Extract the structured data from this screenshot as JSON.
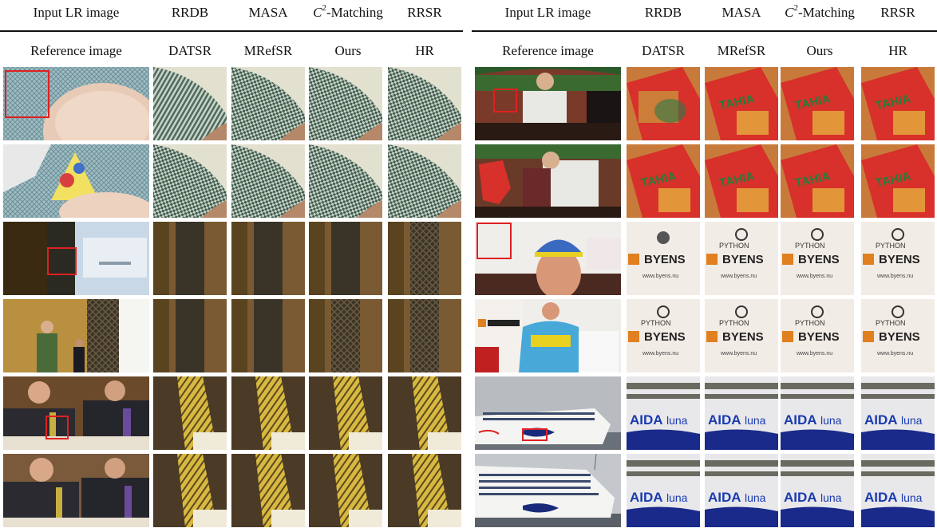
{
  "left_panel": {
    "header_row_1": [
      "Input LR image",
      "RRDB",
      "MASA",
      "C2-Matching",
      "RRSR"
    ],
    "header_row_2": [
      "Reference image",
      "DATSR",
      "MRefSR",
      "Ours",
      "HR"
    ]
  },
  "right_panel": {
    "header_row_1": [
      "Input LR image",
      "RRDB",
      "MASA",
      "C2-Matching",
      "RRSR"
    ],
    "header_row_2": [
      "Reference image",
      "DATSR",
      "MRefSR",
      "Ours",
      "HR"
    ]
  },
  "c2_label": {
    "letter": "C",
    "sup": "2",
    "rest": "-Matching"
  },
  "right_crop_texts": {
    "yuyis": "TAHIA",
    "logo_top": "PYTHON",
    "logo_mid": "BYENS",
    "logo_url": "www.byens.nu",
    "aida": "AIDA",
    "luna": "luna"
  }
}
